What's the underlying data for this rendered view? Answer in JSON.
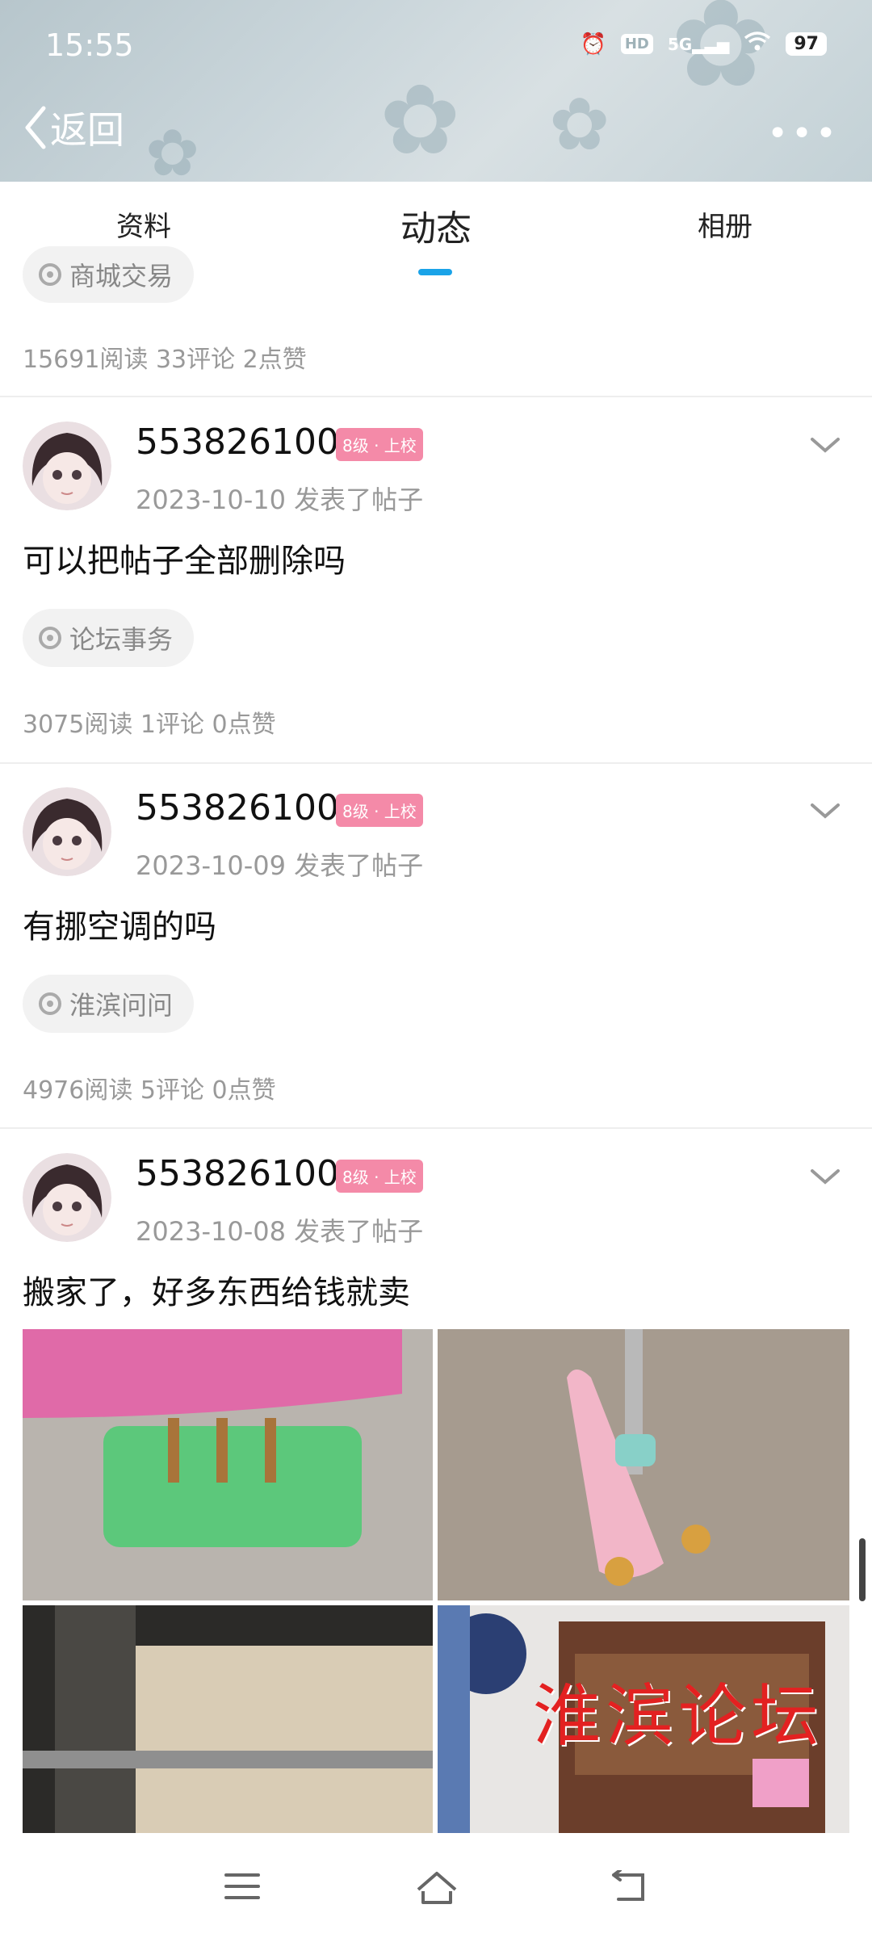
{
  "status": {
    "time": "15:55",
    "hd": "HD",
    "network": "5G",
    "battery": "97"
  },
  "header": {
    "back_label": "返回"
  },
  "tabs": [
    "资料",
    "动态",
    "相册"
  ],
  "first_card": {
    "chip_label": "商城交易",
    "stats": "15691阅读 33评论 2点赞"
  },
  "posts": [
    {
      "username": "553826100",
      "level": "8级 · 上校",
      "date": "2023-10-10",
      "action": "发表了帖子",
      "title": "可以把帖子全部删除吗",
      "tag": "论坛事务",
      "stats": "3075阅读 1评论 0点赞"
    },
    {
      "username": "553826100",
      "level": "8级 · 上校",
      "date": "2023-10-09",
      "action": "发表了帖子",
      "title": "有挪空调的吗",
      "tag": "淮滨问问",
      "stats": "4976阅读 5评论 0点赞"
    },
    {
      "username": "553826100",
      "level": "8级 · 上校",
      "date": "2023-10-08",
      "action": "发表了帖子",
      "title": "搬家了，好多东西给钱就卖"
    }
  ],
  "watermark": "淮滨论坛",
  "colors": {
    "accent": "#1aa3e8",
    "level_badge": "#f48aa8",
    "header": "#c3d1d6"
  }
}
